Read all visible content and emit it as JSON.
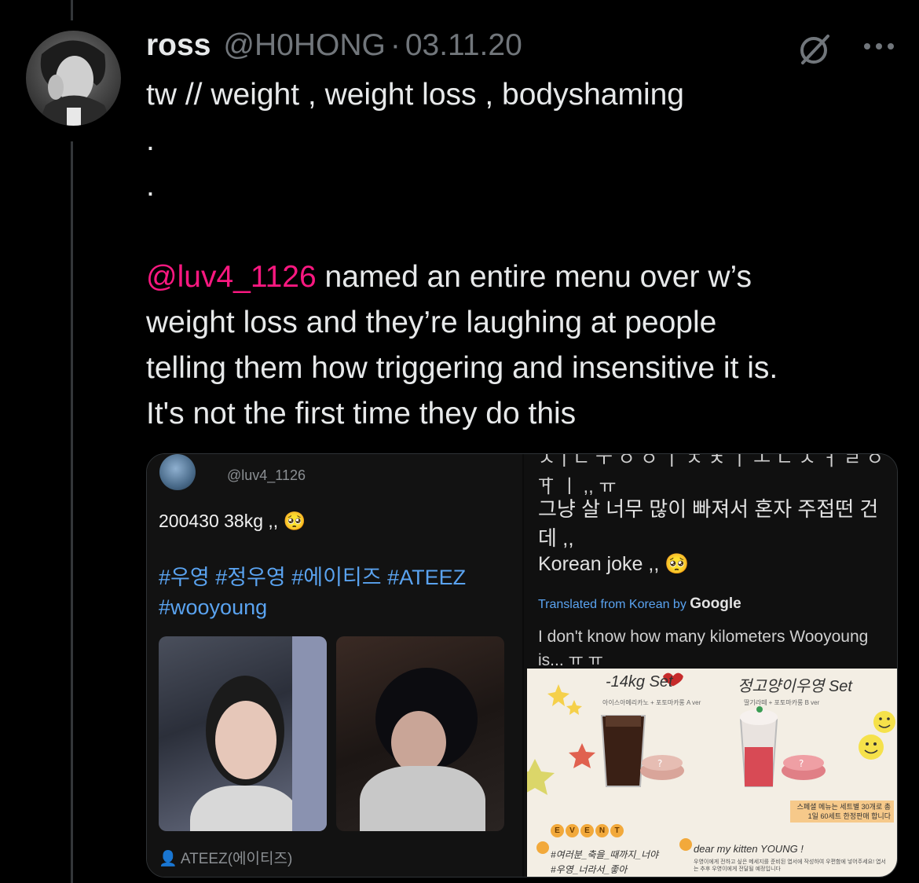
{
  "tweet": {
    "name": "ross",
    "handle": "@H0HONG",
    "separator": "·",
    "date": "03.11.20",
    "trigger_warning": "tw // weight , weight loss , bodyshaming",
    "dot_1": ".",
    "dot_2": ".",
    "mention": "@luv4_1126",
    "line_1_rest": " named an entire menu over w’s",
    "line_2": "weight loss and they’re laughing at people",
    "line_3": "telling them how triggering and insensitive it is.",
    "line_4": "It's not the first time they do this"
  },
  "icons": {
    "grok": "slashed-circle-icon",
    "more": "more-dots-icon"
  },
  "left_screenshot": {
    "handle": "@luv4_1126",
    "text": "200430 38kg ,, 🥺",
    "hashtags_1": "#우영 #정우영 #에이티즈  #ATEEZ",
    "hashtags_2": "#wooyoung",
    "source": "ATEEZ(에이티즈)"
  },
  "right_screenshot": {
    "cut_line": "ㅅㅣㄴ ㅜ ㅇ ㅇ ㅣ ㅈ ㅊ ㅣ ㅗ ㄴ ㅅ ㅓ ㄹ ㅇ ㅓ ㅣ ,, ㅠ",
    "tt": "ㅠ",
    "korean": "그냥 살 너무 많이 빠져서 혼자 주접떤 건데 ,,",
    "joke": "Korean joke ,, 🥺",
    "translated_label": "Translated from Korean by",
    "google": "Google",
    "translation": "I don't know how many kilometers Wooyoung is... ㅠ ㅠ"
  },
  "menu_card": {
    "title_1": "-14kg Set",
    "title_2": "정고양이우영 Set",
    "sub_1": "아이스아메리카노 + 포토마카롱 A ver",
    "sub_2": "딸기라떼 + 포토마카롱 B ver",
    "notice": "스페셜 메뉴는 세트별 30개로 총 1일 60세트 한정판매 합니다",
    "event_letters": [
      "E",
      "V",
      "E",
      "N",
      "T"
    ],
    "line_1": "#여러분_축을_때까지_너야",
    "line_2": "#우영_너라서_좋아",
    "line_3": "dear my kitten YOUNG !",
    "line_4": "우영이에게 전하고 싶은 메세지를 준비된 엽서에 작성하여 우편함에 넣어주세요! 엽서는 추후 우영이에게 전달될 예정입니다"
  },
  "colors": {
    "background": "#000000",
    "text": "#e7e9ea",
    "secondary": "#71767b",
    "mention": "#f91880",
    "hashtag": "#5aa3f0"
  }
}
